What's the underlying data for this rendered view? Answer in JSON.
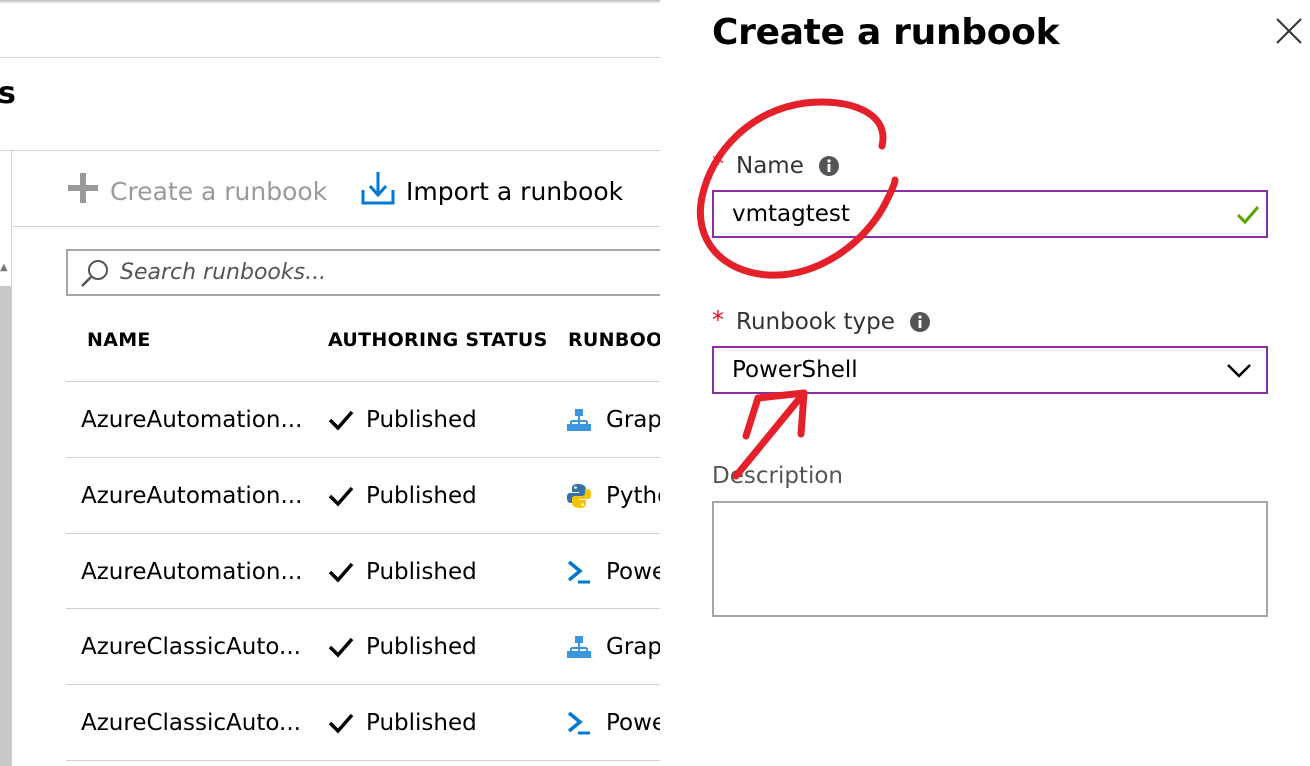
{
  "blade": {
    "title_fragment": "s",
    "commands": {
      "create_label": "Create a runbook",
      "import_label": "Import a runbook"
    },
    "search": {
      "placeholder": "Search runbooks..."
    },
    "columns": [
      "NAME",
      "AUTHORING STATUS",
      "RUNBOO"
    ],
    "rows": [
      {
        "name": "AzureAutomation...",
        "status": "Published",
        "type": "Grap",
        "type_icon": "graphical-icon"
      },
      {
        "name": "AzureAutomation...",
        "status": "Published",
        "type": "Pytho",
        "type_icon": "python-icon"
      },
      {
        "name": "AzureAutomation...",
        "status": "Published",
        "type": "Powe",
        "type_icon": "powershell-icon"
      },
      {
        "name": "AzureClassicAuto...",
        "status": "Published",
        "type": "Grap",
        "type_icon": "graphical-icon"
      },
      {
        "name": "AzureClassicAuto...",
        "status": "Published",
        "type": "Powe",
        "type_icon": "powershell-icon"
      }
    ]
  },
  "panel": {
    "title": "Create a runbook",
    "name_field": {
      "label": "Name",
      "required_mark": "*",
      "value": "vmtagtest",
      "valid": true
    },
    "type_field": {
      "label": "Runbook type",
      "required_mark": "*",
      "value": "PowerShell"
    },
    "description_field": {
      "label": "Description",
      "value": ""
    }
  },
  "colors": {
    "accent_border": "#8a2da5",
    "required": "#e81123",
    "valid_check": "#57a300",
    "azure_blue": "#0078d4",
    "annotation": "#e4202a"
  }
}
